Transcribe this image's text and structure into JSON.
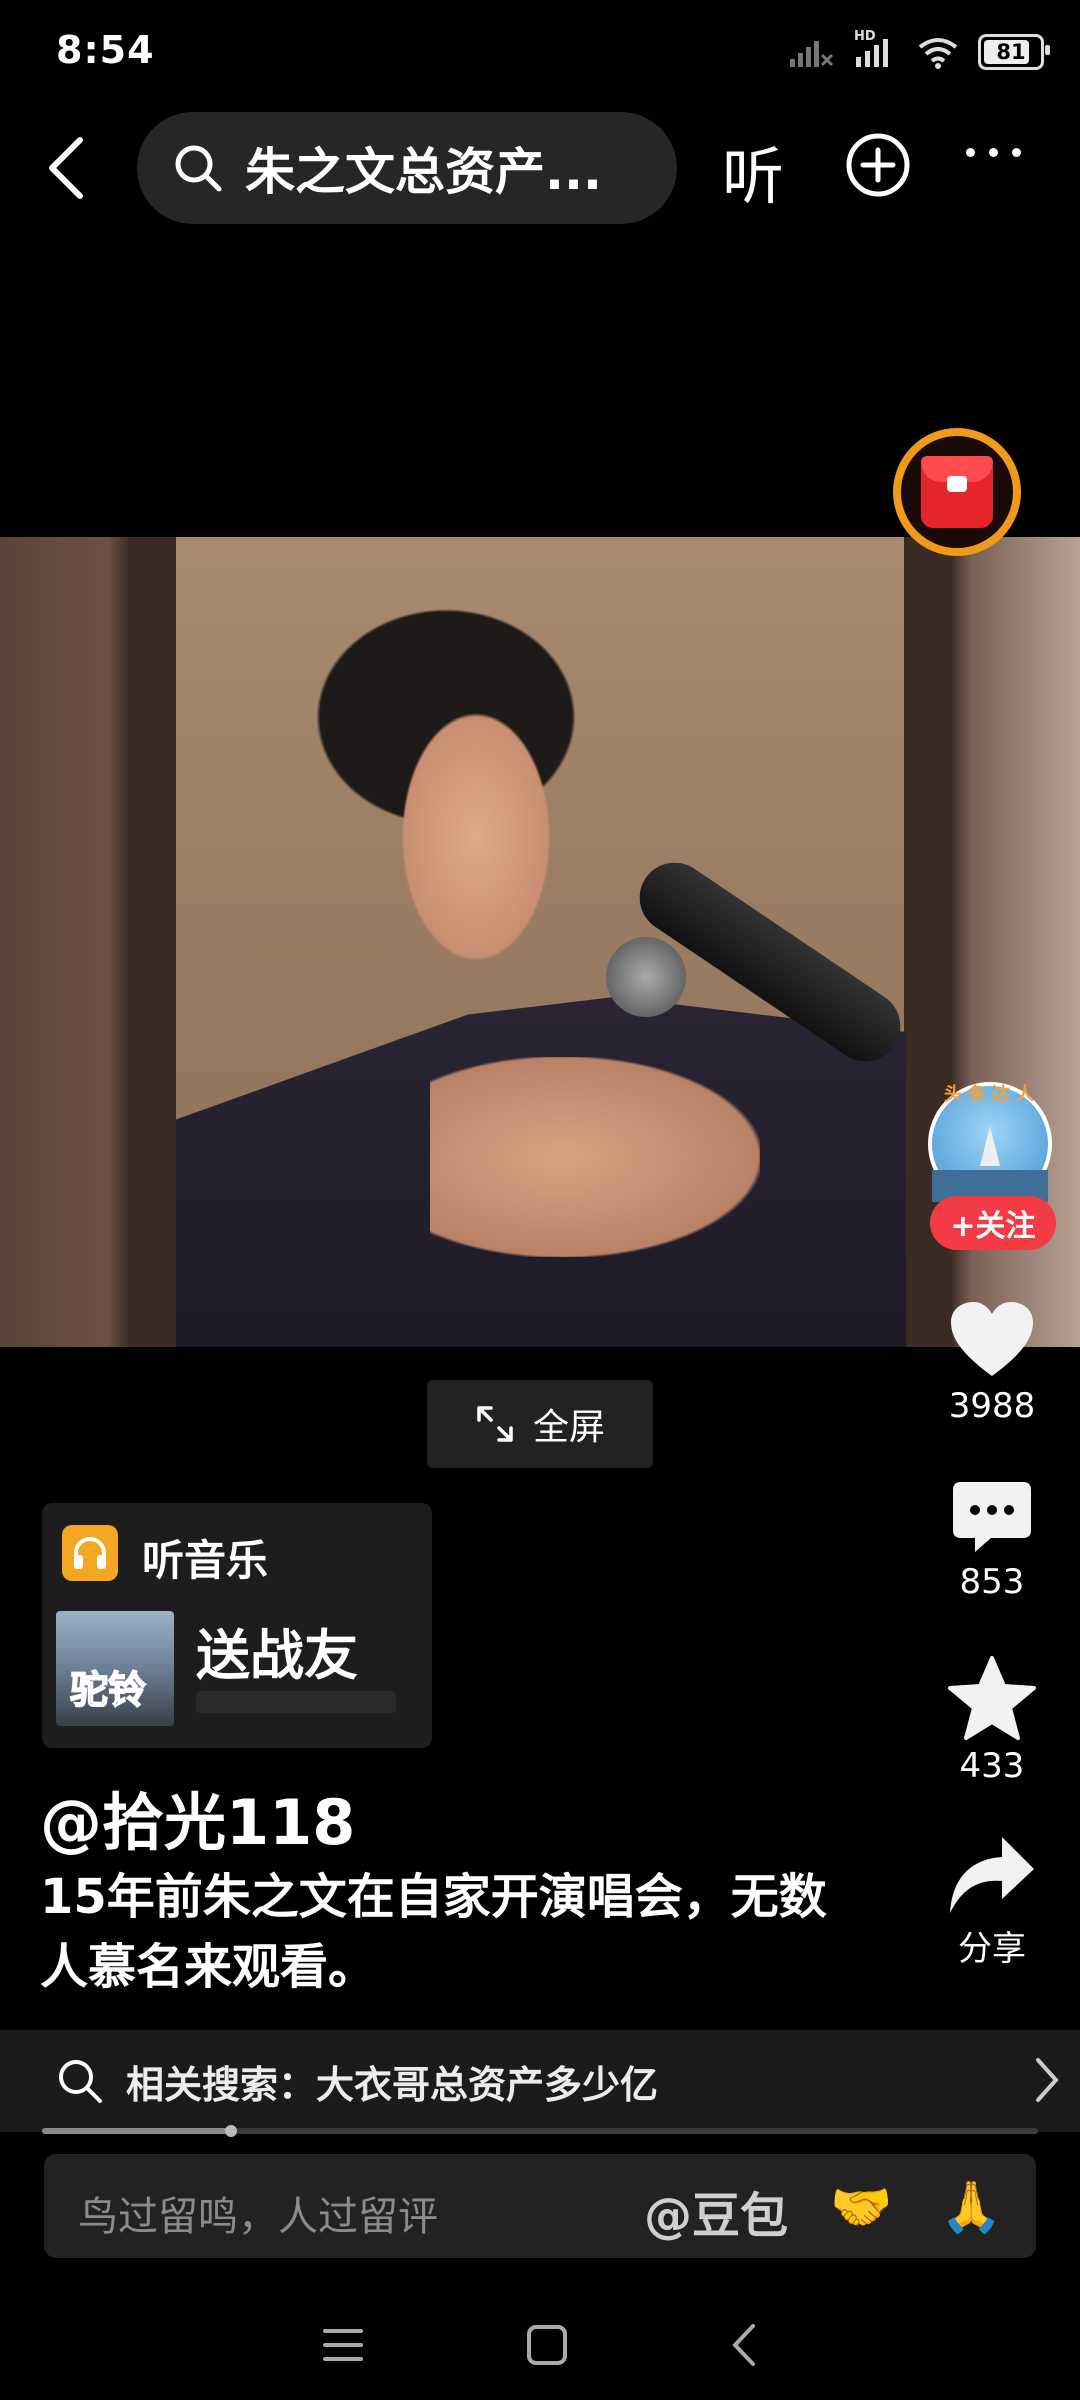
{
  "status_bar": {
    "time": "8:54",
    "battery": "81",
    "signal_label": "HD"
  },
  "top_bar": {
    "search_text": "朱之文总资产...",
    "listen_label": "听"
  },
  "video": {
    "fullscreen_label": "全屏"
  },
  "author_rail": {
    "badge_text": "头条达人",
    "follow_label": "+关注",
    "likes": "3988",
    "comments": "853",
    "favorites": "433",
    "share_label": "分享"
  },
  "music": {
    "section_label": "听音乐",
    "cover_text": "驼铃",
    "song_title": "送战友"
  },
  "post": {
    "author": "@拾光118",
    "caption": "15年前朱之文在自家开演唱会，无数人慕名来观看。"
  },
  "related_search": {
    "text": "相关搜索：大衣哥总资产多少亿"
  },
  "playback": {
    "progress_fraction": 0.19
  },
  "comment_bar": {
    "placeholder": "鸟过留鸣，人过留评",
    "mention": "@豆包",
    "emoji_1": "🤝",
    "emoji_2": "🙏"
  },
  "colors": {
    "accent_red": "#f23b45",
    "red_packet_ring": "#f19a1a",
    "music_icon": "#f5a623"
  }
}
